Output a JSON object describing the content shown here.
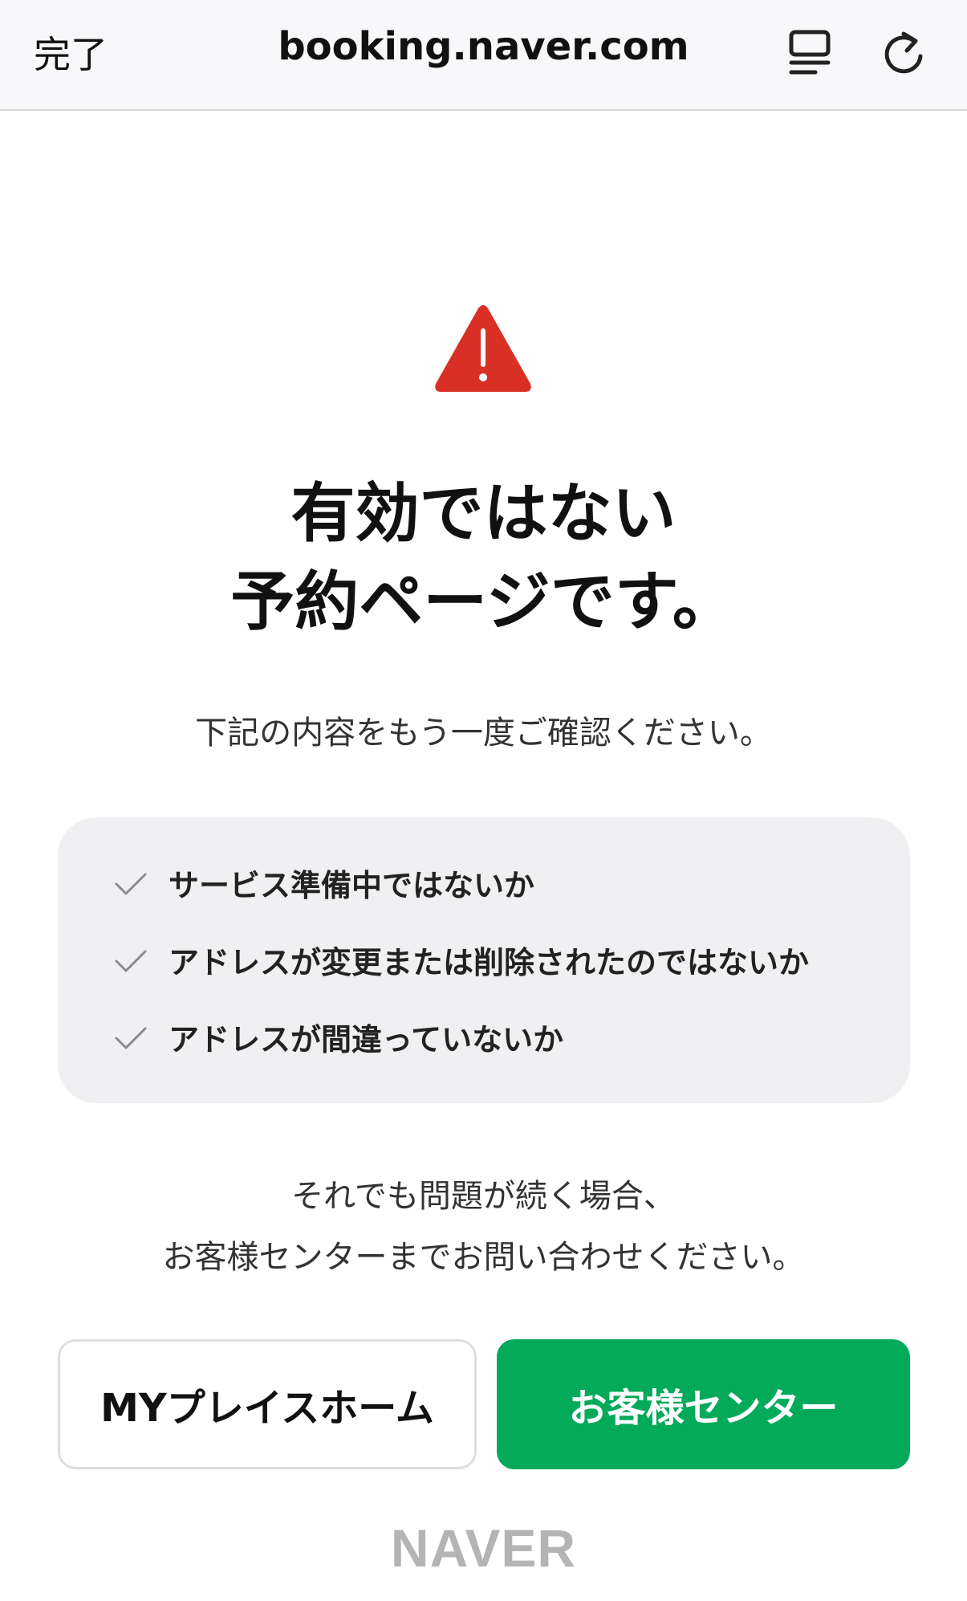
{
  "browser": {
    "done_label": "完了",
    "url": "booking.naver.com",
    "reader_icon": "reader-view-icon",
    "reload_icon": "reload-icon"
  },
  "warning_icon": "warning-triangle-icon",
  "colors": {
    "warning": "#d93025",
    "primary": "#03aa5a",
    "panel_bg": "#f0f0f2",
    "logo": "#b4b4b4"
  },
  "headline": {
    "line1": "有効ではない",
    "line2": "予約ページです。"
  },
  "subtitle": "下記の内容をもう一度ご確認ください。",
  "checklist": [
    "サービス準備中ではないか",
    "アドレスが変更または削除されたのではないか",
    "アドレスが間違っていないか"
  ],
  "contact": {
    "line1": "それでも問題が続く場合、",
    "line2": "お客様センターまでお問い合わせください。"
  },
  "buttons": {
    "home_label": "MYプレイスホーム",
    "support_label": "お客様センター"
  },
  "footer_logo": "NAVER"
}
